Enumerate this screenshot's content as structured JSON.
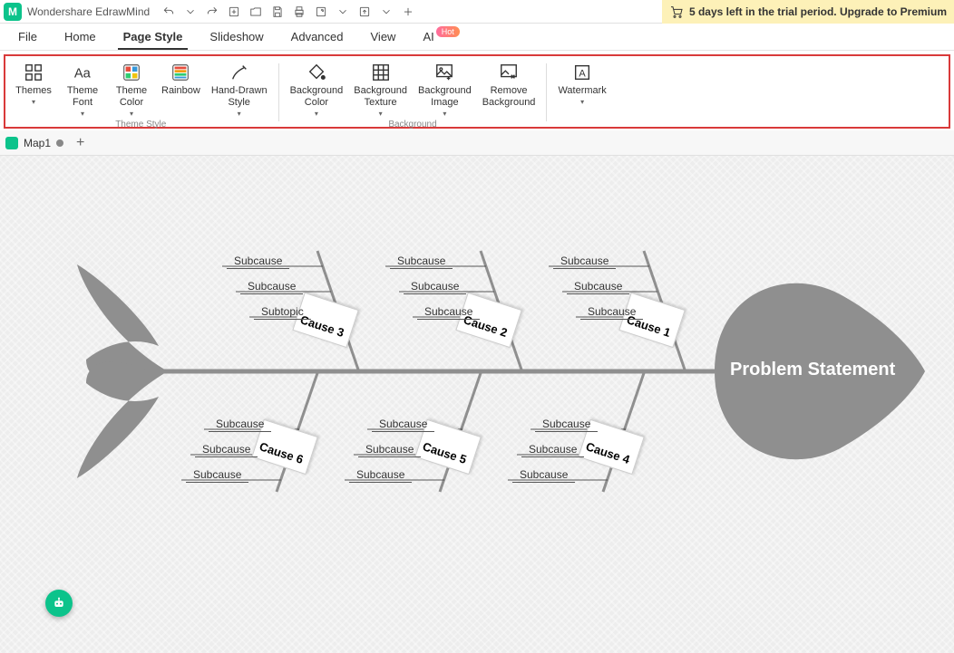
{
  "app": {
    "name": "Wondershare EdrawMind"
  },
  "trial": {
    "text": "5 days left in the trial period. Upgrade to Premium"
  },
  "menu": {
    "file": "File",
    "home": "Home",
    "pageStyle": "Page Style",
    "slideshow": "Slideshow",
    "advanced": "Advanced",
    "view": "View",
    "ai": "AI",
    "hot": "Hot"
  },
  "ribbon": {
    "themes": "Themes",
    "themeFont": "Theme\nFont",
    "themeColor": "Theme\nColor",
    "rainbow": "Rainbow",
    "handDrawn": "Hand-Drawn\nStyle",
    "bgColor": "Background\nColor",
    "bgTexture": "Background\nTexture",
    "bgImage": "Background\nImage",
    "removeBg": "Remove\nBackground",
    "watermark": "Watermark",
    "grpThemeStyle": "Theme Style",
    "grpBackground": "Background"
  },
  "doc": {
    "tab1": "Map1"
  },
  "diagram": {
    "head": "Problem Statement",
    "c1": "Cause 1",
    "c2": "Cause 2",
    "c3": "Cause 3",
    "c4": "Cause 4",
    "c5": "Cause 5",
    "c6": "Cause 6",
    "c1s": [
      "Subcause",
      "Subcause",
      "Subcause"
    ],
    "c2s": [
      "Subcause",
      "Subcause",
      "Subcause"
    ],
    "c3s": [
      "Subcause",
      "Subcause",
      "Subtopic"
    ],
    "c4s": [
      "Subcause",
      "Subcause",
      "Subcause"
    ],
    "c5s": [
      "Subcause",
      "Subcause",
      "Subcause"
    ],
    "c6s": [
      "Subcause",
      "Subcause",
      "Subcause"
    ]
  }
}
